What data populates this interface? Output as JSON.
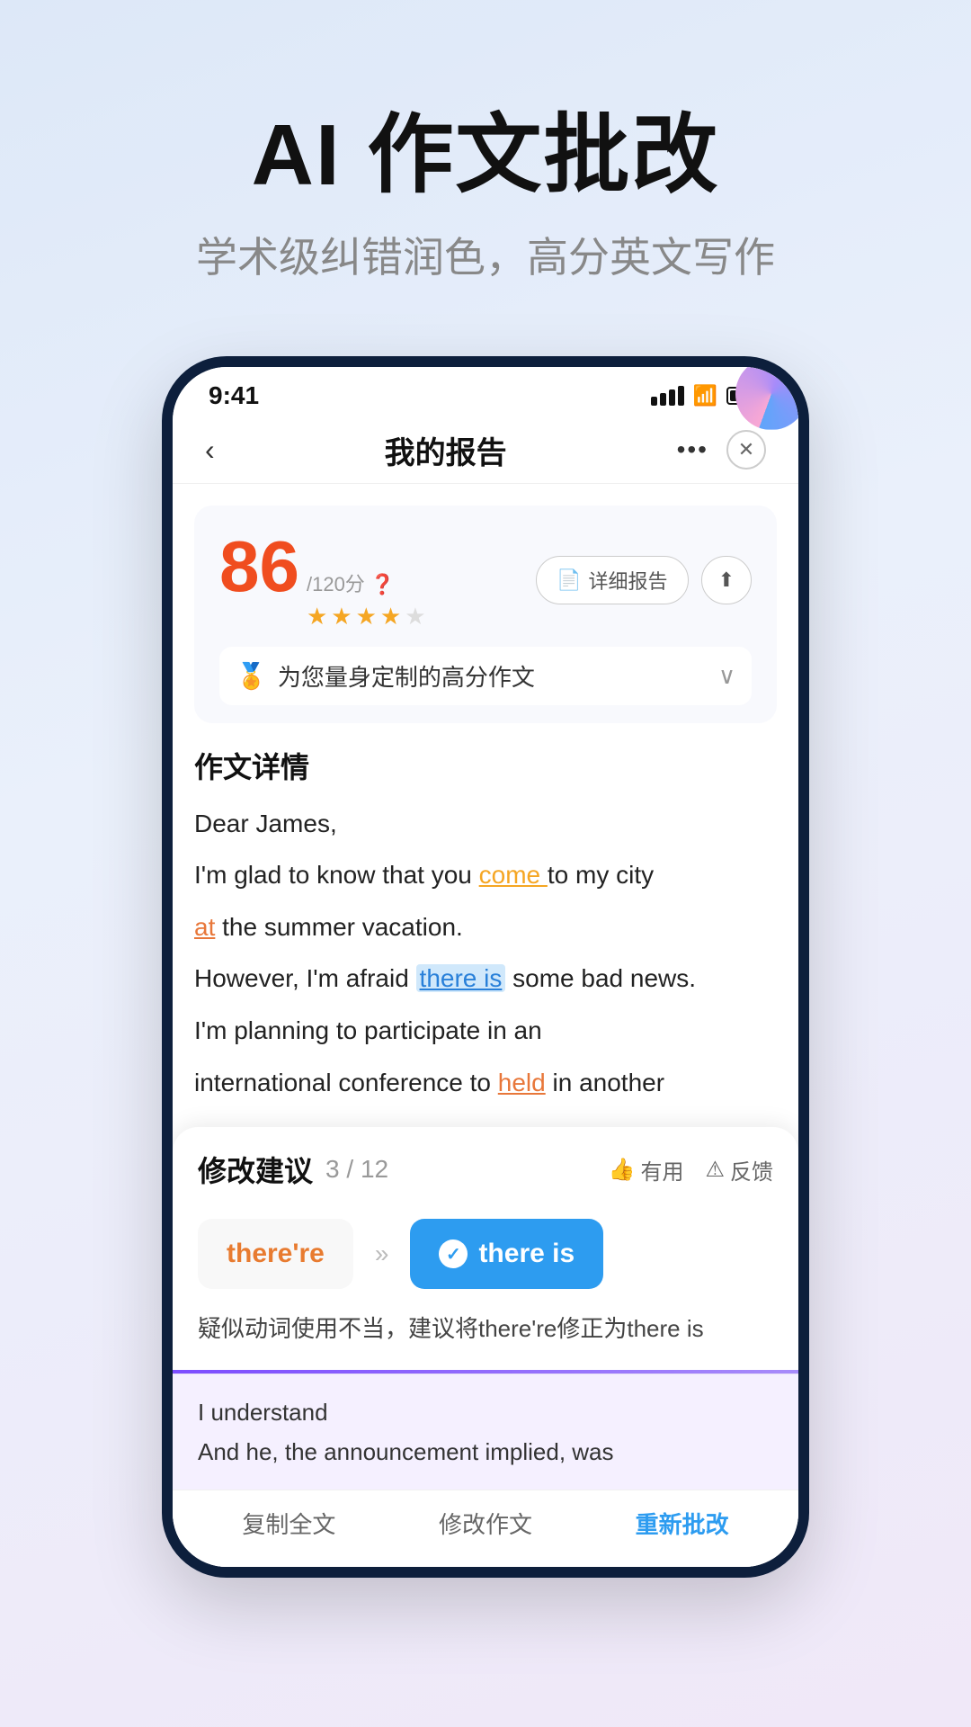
{
  "hero": {
    "title": "AI 作文批改",
    "subtitle": "学术级纠错润色，高分英文写作"
  },
  "phone": {
    "status_time": "9:41",
    "nav_title": "我的报告",
    "score": "86",
    "score_max": "/120分",
    "score_question": "?",
    "stars_filled": 4,
    "stars_total": 5,
    "btn_report": "详细报告",
    "btn_share": "↑",
    "tip_text": "为您量身定制的高分作文",
    "section_title": "作文详情",
    "essay": {
      "line1": "Dear James,",
      "line2_pre": "I'm glad to know that you ",
      "line2_highlight": "come",
      "line2_post": " to my city",
      "line3_pre": "",
      "line3_highlight_orange": "at",
      "line3_post": " the summer vacation.",
      "line4_pre": "However, I'm afraid ",
      "line4_highlight_blue": "there is",
      "line4_post": " some bad news.",
      "line5": "I'm planning to participate in an",
      "line6_pre": "international conference to ",
      "line6_highlight": "held",
      "line6_post": " in another"
    },
    "suggestion": {
      "title": "修改建议",
      "current": "3",
      "total": "12",
      "action_useful": "有用",
      "action_feedback": "反馈",
      "original": "there're",
      "suggested": "there is",
      "explanation": "疑似动词使用不当，建议将there're修正为there is"
    },
    "extra_lines": {
      "line1": "I understand",
      "line2": "And he, the announcement implied, was"
    },
    "bottom_actions": {
      "copy": "复制全文",
      "edit": "修改作文",
      "resubmit": "重新批改"
    }
  }
}
